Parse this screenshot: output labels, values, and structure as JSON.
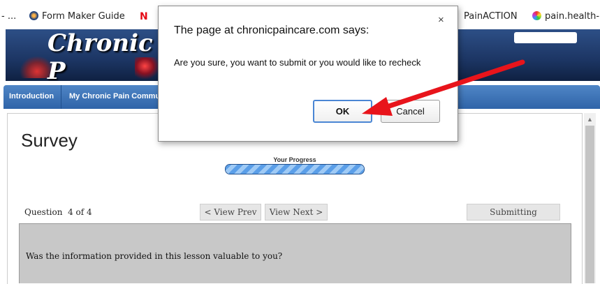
{
  "bookmarks": [
    {
      "label": "- ...",
      "icon": "globe-icon"
    },
    {
      "label": "Form Maker Guide",
      "icon": "compass-icon"
    },
    {
      "label": "N",
      "icon": "netflix-icon"
    },
    {
      "label": "PainACTION",
      "icon": ""
    },
    {
      "label": "pain.health-",
      "icon": "color-wheel-icon"
    }
  ],
  "site": {
    "logo_text": "Chronic P",
    "nav": [
      {
        "label": "Introduction"
      },
      {
        "label": "My Chronic Pain Commu"
      }
    ]
  },
  "dialog": {
    "title": "The page at chronicpaincare.com says:",
    "close_label": "×",
    "message": "Are you sure, you want to submit or you would like to recheck",
    "ok_label": "OK",
    "cancel_label": "Cancel"
  },
  "survey": {
    "title": "Survey",
    "progress_label": "Your Progress",
    "progress_fraction": 1.0,
    "question_label": "Question",
    "question_count": "4 of 4",
    "view_prev_label": "< View Prev",
    "view_next_label": "View Next >",
    "submit_label": "Submitting",
    "question_text": "Was the information provided in this lesson valuable to you?"
  },
  "colors": {
    "nav_blue": "#2f64a8",
    "dialog_ok_border": "#4a86d4",
    "annotation_arrow": "#e8141b"
  }
}
